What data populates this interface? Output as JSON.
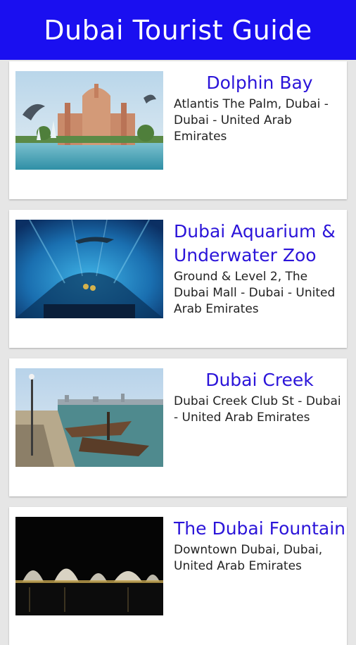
{
  "app": {
    "title": "Dubai Tourist Guide"
  },
  "places": [
    {
      "name": "Dolphin Bay",
      "address": "Atlantis The Palm, Dubai - Dubai - United Arab Emirates",
      "image": "dolphin-bay-photo"
    },
    {
      "name": "Dubai Aquarium & Underwater Zoo",
      "address": "Ground & Level 2, The Dubai Mall - Dubai - United Arab Emirates",
      "image": "aquarium-tunnel-photo"
    },
    {
      "name": "Dubai Creek",
      "address": "Dubai Creek Club St - Dubai - United Arab Emirates",
      "image": "creek-waterfront-photo"
    },
    {
      "name": "The Dubai Fountain",
      "address": "Downtown Dubai, Dubai, United Arab Emirates",
      "image": "fountain-night-photo"
    }
  ],
  "colors": {
    "appbar": "#1a0ff0",
    "title_text": "#2b14d9",
    "background": "#e6e6e6"
  }
}
